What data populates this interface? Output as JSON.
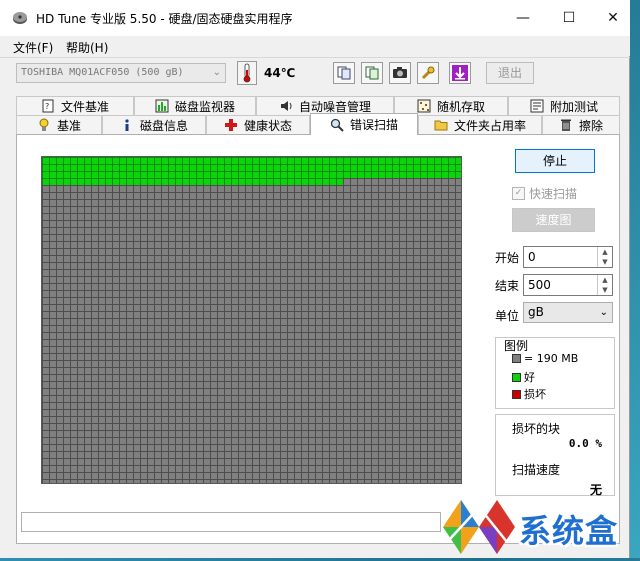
{
  "window": {
    "title": "HD Tune 专业版 5.50 - 硬盘/固态硬盘实用程序",
    "minimize": "—",
    "maximize": "☐",
    "close": "✕"
  },
  "menu": {
    "file": "文件(F)",
    "help": "帮助(H)"
  },
  "toolbar": {
    "drive": "TOSHIBA MQ01ACF050 (500 gB)",
    "temperature": "44℃",
    "exit_label": "退出"
  },
  "tabs_top": [
    {
      "label": "文件基准",
      "icon": "file-benchmark-icon"
    },
    {
      "label": "磁盘监视器",
      "icon": "disk-monitor-icon"
    },
    {
      "label": "自动噪音管理",
      "icon": "speaker-icon"
    },
    {
      "label": "随机存取",
      "icon": "random-access-icon"
    },
    {
      "label": "附加测试",
      "icon": "extra-tests-icon"
    }
  ],
  "tabs_bottom": [
    {
      "label": "基准",
      "icon": "benchmark-icon"
    },
    {
      "label": "磁盘信息",
      "icon": "info-icon"
    },
    {
      "label": "健康状态",
      "icon": "health-cross-icon"
    },
    {
      "label": "错误扫描",
      "icon": "magnifier-icon",
      "active": true
    },
    {
      "label": "文件夹占用率",
      "icon": "folder-icon"
    },
    {
      "label": "擦除",
      "icon": "trash-icon"
    }
  ],
  "scan": {
    "progress_fraction": 0.14,
    "block_colors": {
      "good": "#0bd40b",
      "unscanned": "#808080",
      "damaged": "#cc0000"
    }
  },
  "controls": {
    "stop_label": "停止",
    "quick_scan_label": "快速扫描",
    "speed_map_label": "速度图",
    "start_label": "开始",
    "start_value": "0",
    "end_label": "结束",
    "end_value": "500",
    "unit_label": "单位",
    "unit_value": "gB"
  },
  "legend": {
    "title": "图例",
    "block_size": "= 190 MB",
    "good": "好",
    "damaged": "损坏"
  },
  "stats": {
    "damaged_blocks_label": "损坏的块",
    "damaged_blocks_value": "0.0 %",
    "scan_speed_label": "扫描速度",
    "scan_speed_value": "无"
  },
  "watermark": {
    "text": "系统盒"
  }
}
